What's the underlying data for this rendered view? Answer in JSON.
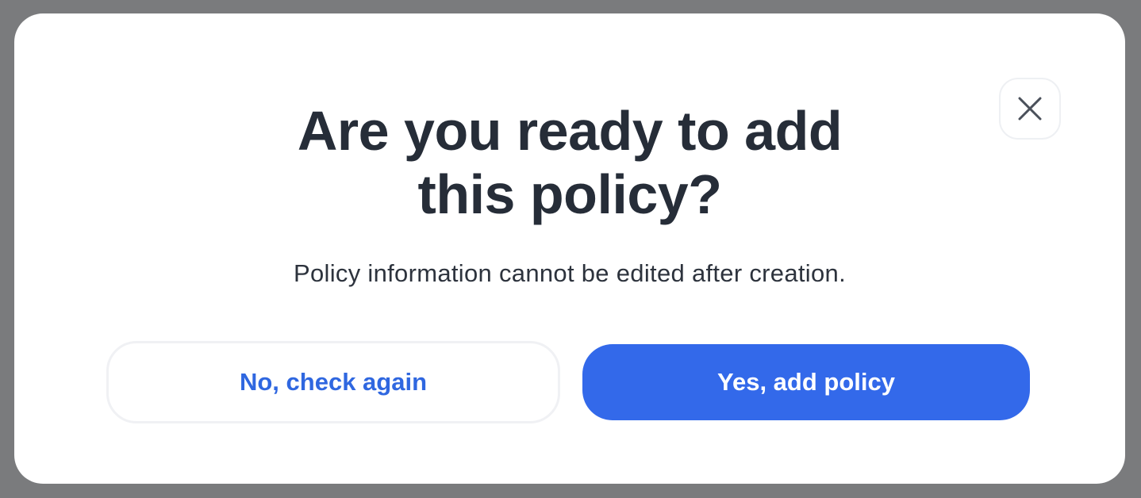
{
  "modal": {
    "title_line1": "Are you ready to add",
    "title_line2": "this policy?",
    "description": "Policy information cannot be edited after creation.",
    "close_icon": "close-icon",
    "secondary_button_label": "No, check again",
    "primary_button_label": "Yes, add policy"
  },
  "colors": {
    "overlay": "#7a7b7d",
    "surface": "#ffffff",
    "title_text": "#262d38",
    "body_text": "#2d333d",
    "accent": "#3369ea",
    "secondary_text": "#2f67e0"
  }
}
